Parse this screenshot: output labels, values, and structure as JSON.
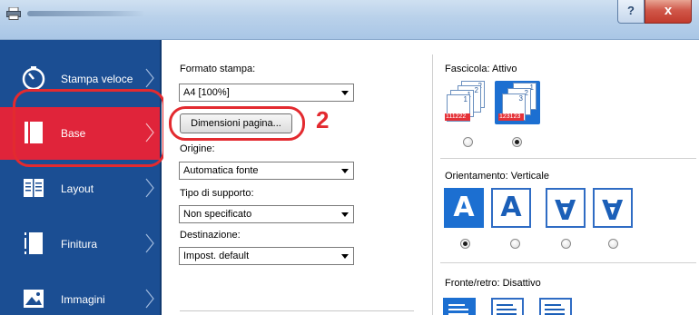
{
  "window": {
    "help_glyph": "?",
    "close_glyph": "x"
  },
  "sidebar": {
    "items": [
      {
        "label": "Stampa veloce",
        "icon": "gauge-icon"
      },
      {
        "label": "Base",
        "icon": "document-icon",
        "selected": true
      },
      {
        "label": "Layout",
        "icon": "layout-icon"
      },
      {
        "label": "Finitura",
        "icon": "finishing-icon"
      },
      {
        "label": "Immagini",
        "icon": "image-icon"
      }
    ]
  },
  "base": {
    "formato_label": "Formato stampa:",
    "formato_value": "A4  [100%]",
    "dimensioni_button": "Dimensioni pagina...",
    "callout_number": "2",
    "origine_label": "Origine:",
    "origine_value": "Automatica fonte",
    "supporto_label": "Tipo di supporto:",
    "supporto_value": "Non specificato",
    "destinazione_label": "Destinazione:",
    "destinazione_value": "Impost. default"
  },
  "right": {
    "fascicola_label": "Fascicola:",
    "fascicola_value": "Attivo",
    "collate_off_pages": [
      "2",
      "2",
      "1",
      "1"
    ],
    "collate_off_strip": "111222",
    "collate_on_pages": [
      "1",
      "2",
      "3"
    ],
    "collate_on_strip": "123123",
    "collate_selected": 1,
    "orientamento_label": "Orientamento:",
    "orientamento_value": "Verticale",
    "orientation_glyph": "A",
    "orientation_selected": 0,
    "fronte_label": "Fronte/retro:",
    "fronte_value": "Disattivo"
  },
  "colors": {
    "sidebar_bg": "#1b4e93",
    "selected_nav": "#e0243a",
    "accent_blue": "#1c6fd1",
    "highlight_red": "#e32a2f"
  }
}
